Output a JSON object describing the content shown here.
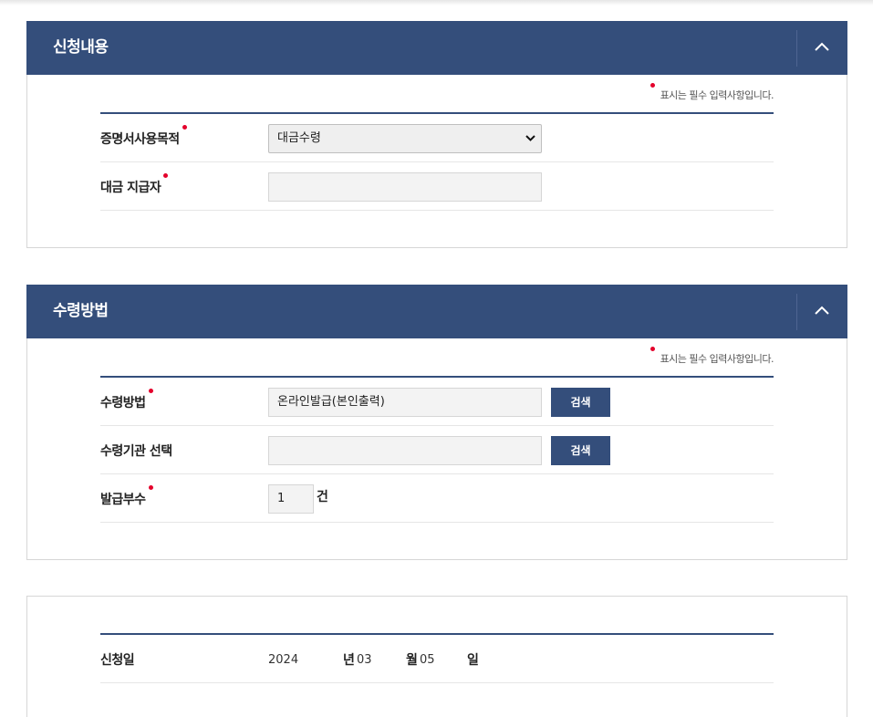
{
  "section1": {
    "title": "신청내용",
    "required_note": "표시는 필수 입력사항입니다.",
    "purpose_label": "증명서사용목적",
    "purpose_value": "대금수령",
    "payer_label": "대금 지급자",
    "payer_value": ""
  },
  "section2": {
    "title": "수령방법",
    "required_note": "표시는 필수 입력사항입니다.",
    "method_label": "수령방법",
    "method_value": "온라인발급(본인출력)",
    "method_search": "검색",
    "agency_label": "수령기관 선택",
    "agency_value": "",
    "agency_search": "검색",
    "copies_label": "발급부수",
    "copies_value": "1",
    "copies_unit": "건"
  },
  "section3": {
    "date_label": "신청일",
    "year": "2024",
    "year_unit": "년",
    "month": "03",
    "month_unit": "월",
    "day": "05",
    "day_unit": "일"
  },
  "colors": {
    "header": "#344e7b",
    "required": "#e4002b"
  },
  "icons": {
    "toggle": "chevron-up-icon",
    "dropdown": "chevron-down-icon"
  }
}
